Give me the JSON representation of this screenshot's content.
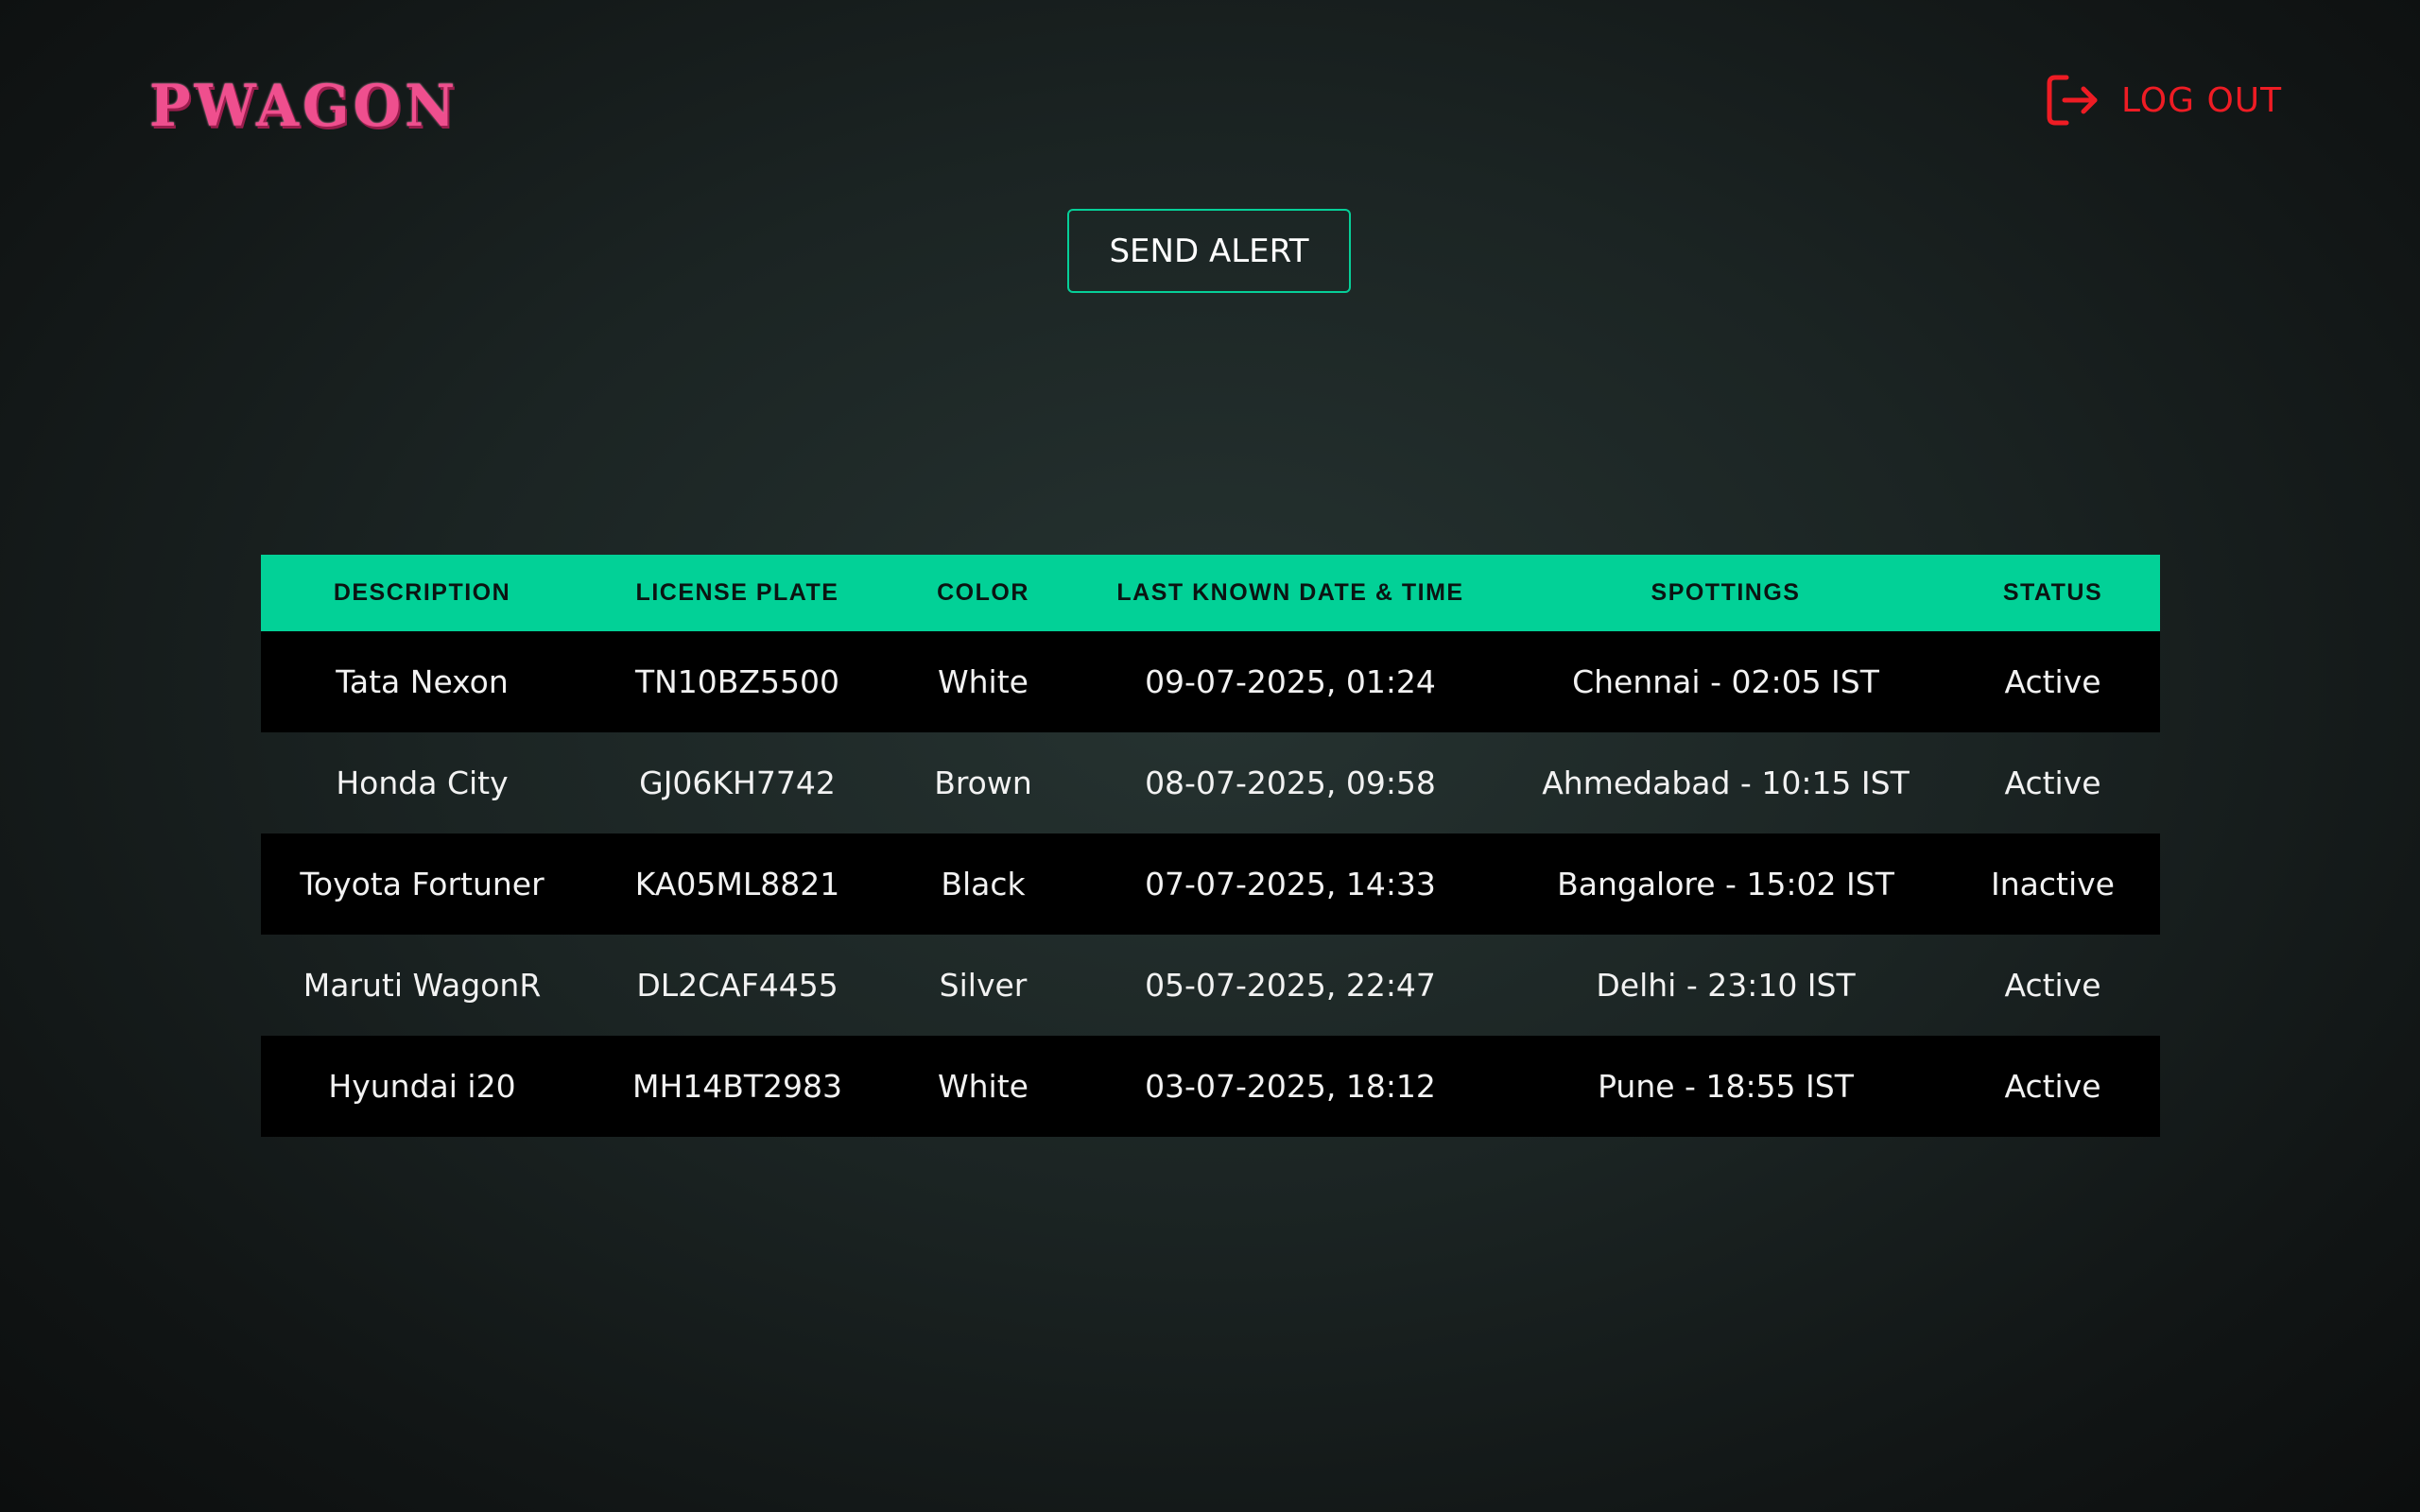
{
  "app": {
    "logo_text": "PWAGON"
  },
  "header": {
    "logout_label": "LOG OUT",
    "logout_icon": "logout-icon",
    "logout_color": "#ee1c24"
  },
  "actions": {
    "send_alert_label": "SEND ALERT",
    "accent_color": "#02d197"
  },
  "table": {
    "columns": [
      "DESCRIPTION",
      "LICENSE PLATE",
      "COLOR",
      "LAST KNOWN DATE & TIME",
      "SPOTTINGS",
      "STATUS"
    ],
    "rows": [
      [
        "Tata Nexon",
        "TN10BZ5500",
        "White",
        "09-07-2025, 01:24",
        "Chennai - 02:05 IST",
        "Active"
      ],
      [
        "Honda City",
        "GJ06KH7742",
        "Brown",
        "08-07-2025, 09:58",
        "Ahmedabad - 10:15 IST",
        "Active"
      ],
      [
        "Toyota Fortuner",
        "KA05ML8821",
        "Black",
        "07-07-2025, 14:33",
        "Bangalore - 15:02 IST",
        "Inactive"
      ],
      [
        "Maruti WagonR",
        "DL2CAF4455",
        "Silver",
        "05-07-2025, 22:47",
        "Delhi - 23:10 IST",
        "Active"
      ],
      [
        "Hyundai i20",
        "MH14BT2983",
        "White",
        "03-07-2025, 18:12",
        "Pune - 18:55 IST",
        "Active"
      ]
    ]
  }
}
